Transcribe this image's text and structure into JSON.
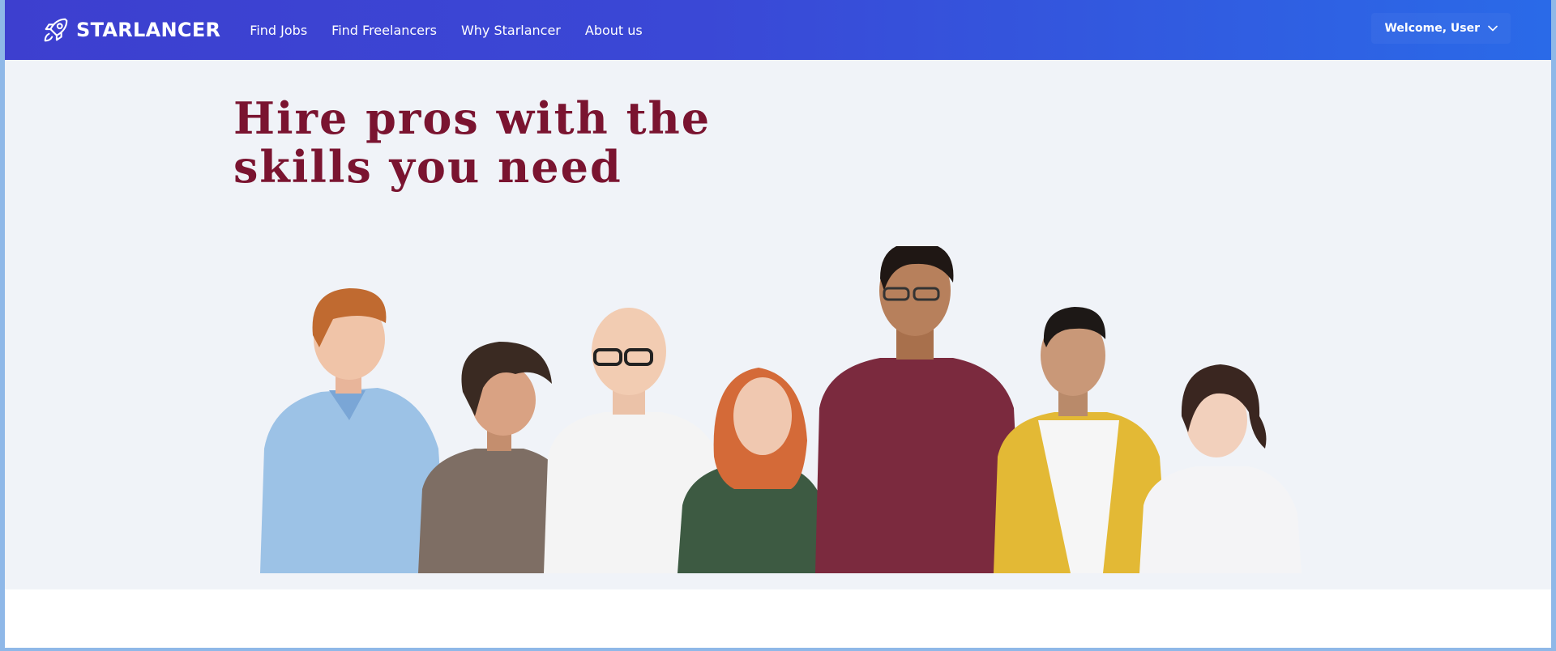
{
  "brand": {
    "name": "STARLANCER",
    "logo_icon": "rocket-icon"
  },
  "nav": {
    "links": [
      {
        "label": "Find Jobs"
      },
      {
        "label": "Find Freelancers"
      },
      {
        "label": "Why Starlancer"
      },
      {
        "label": "About us"
      }
    ]
  },
  "user_menu": {
    "label": "Welcome, User",
    "icon": "chevron-down-icon"
  },
  "hero": {
    "title_line1": "Hire pros with the",
    "title_line2": "skills you need",
    "image": "group-of-diverse-professionals-photo"
  },
  "colors": {
    "nav_gradient_start": "#3d3fcf",
    "nav_gradient_end": "#2a6ae8",
    "headline": "#7a1430",
    "hero_bg": "#f0f3f8"
  }
}
